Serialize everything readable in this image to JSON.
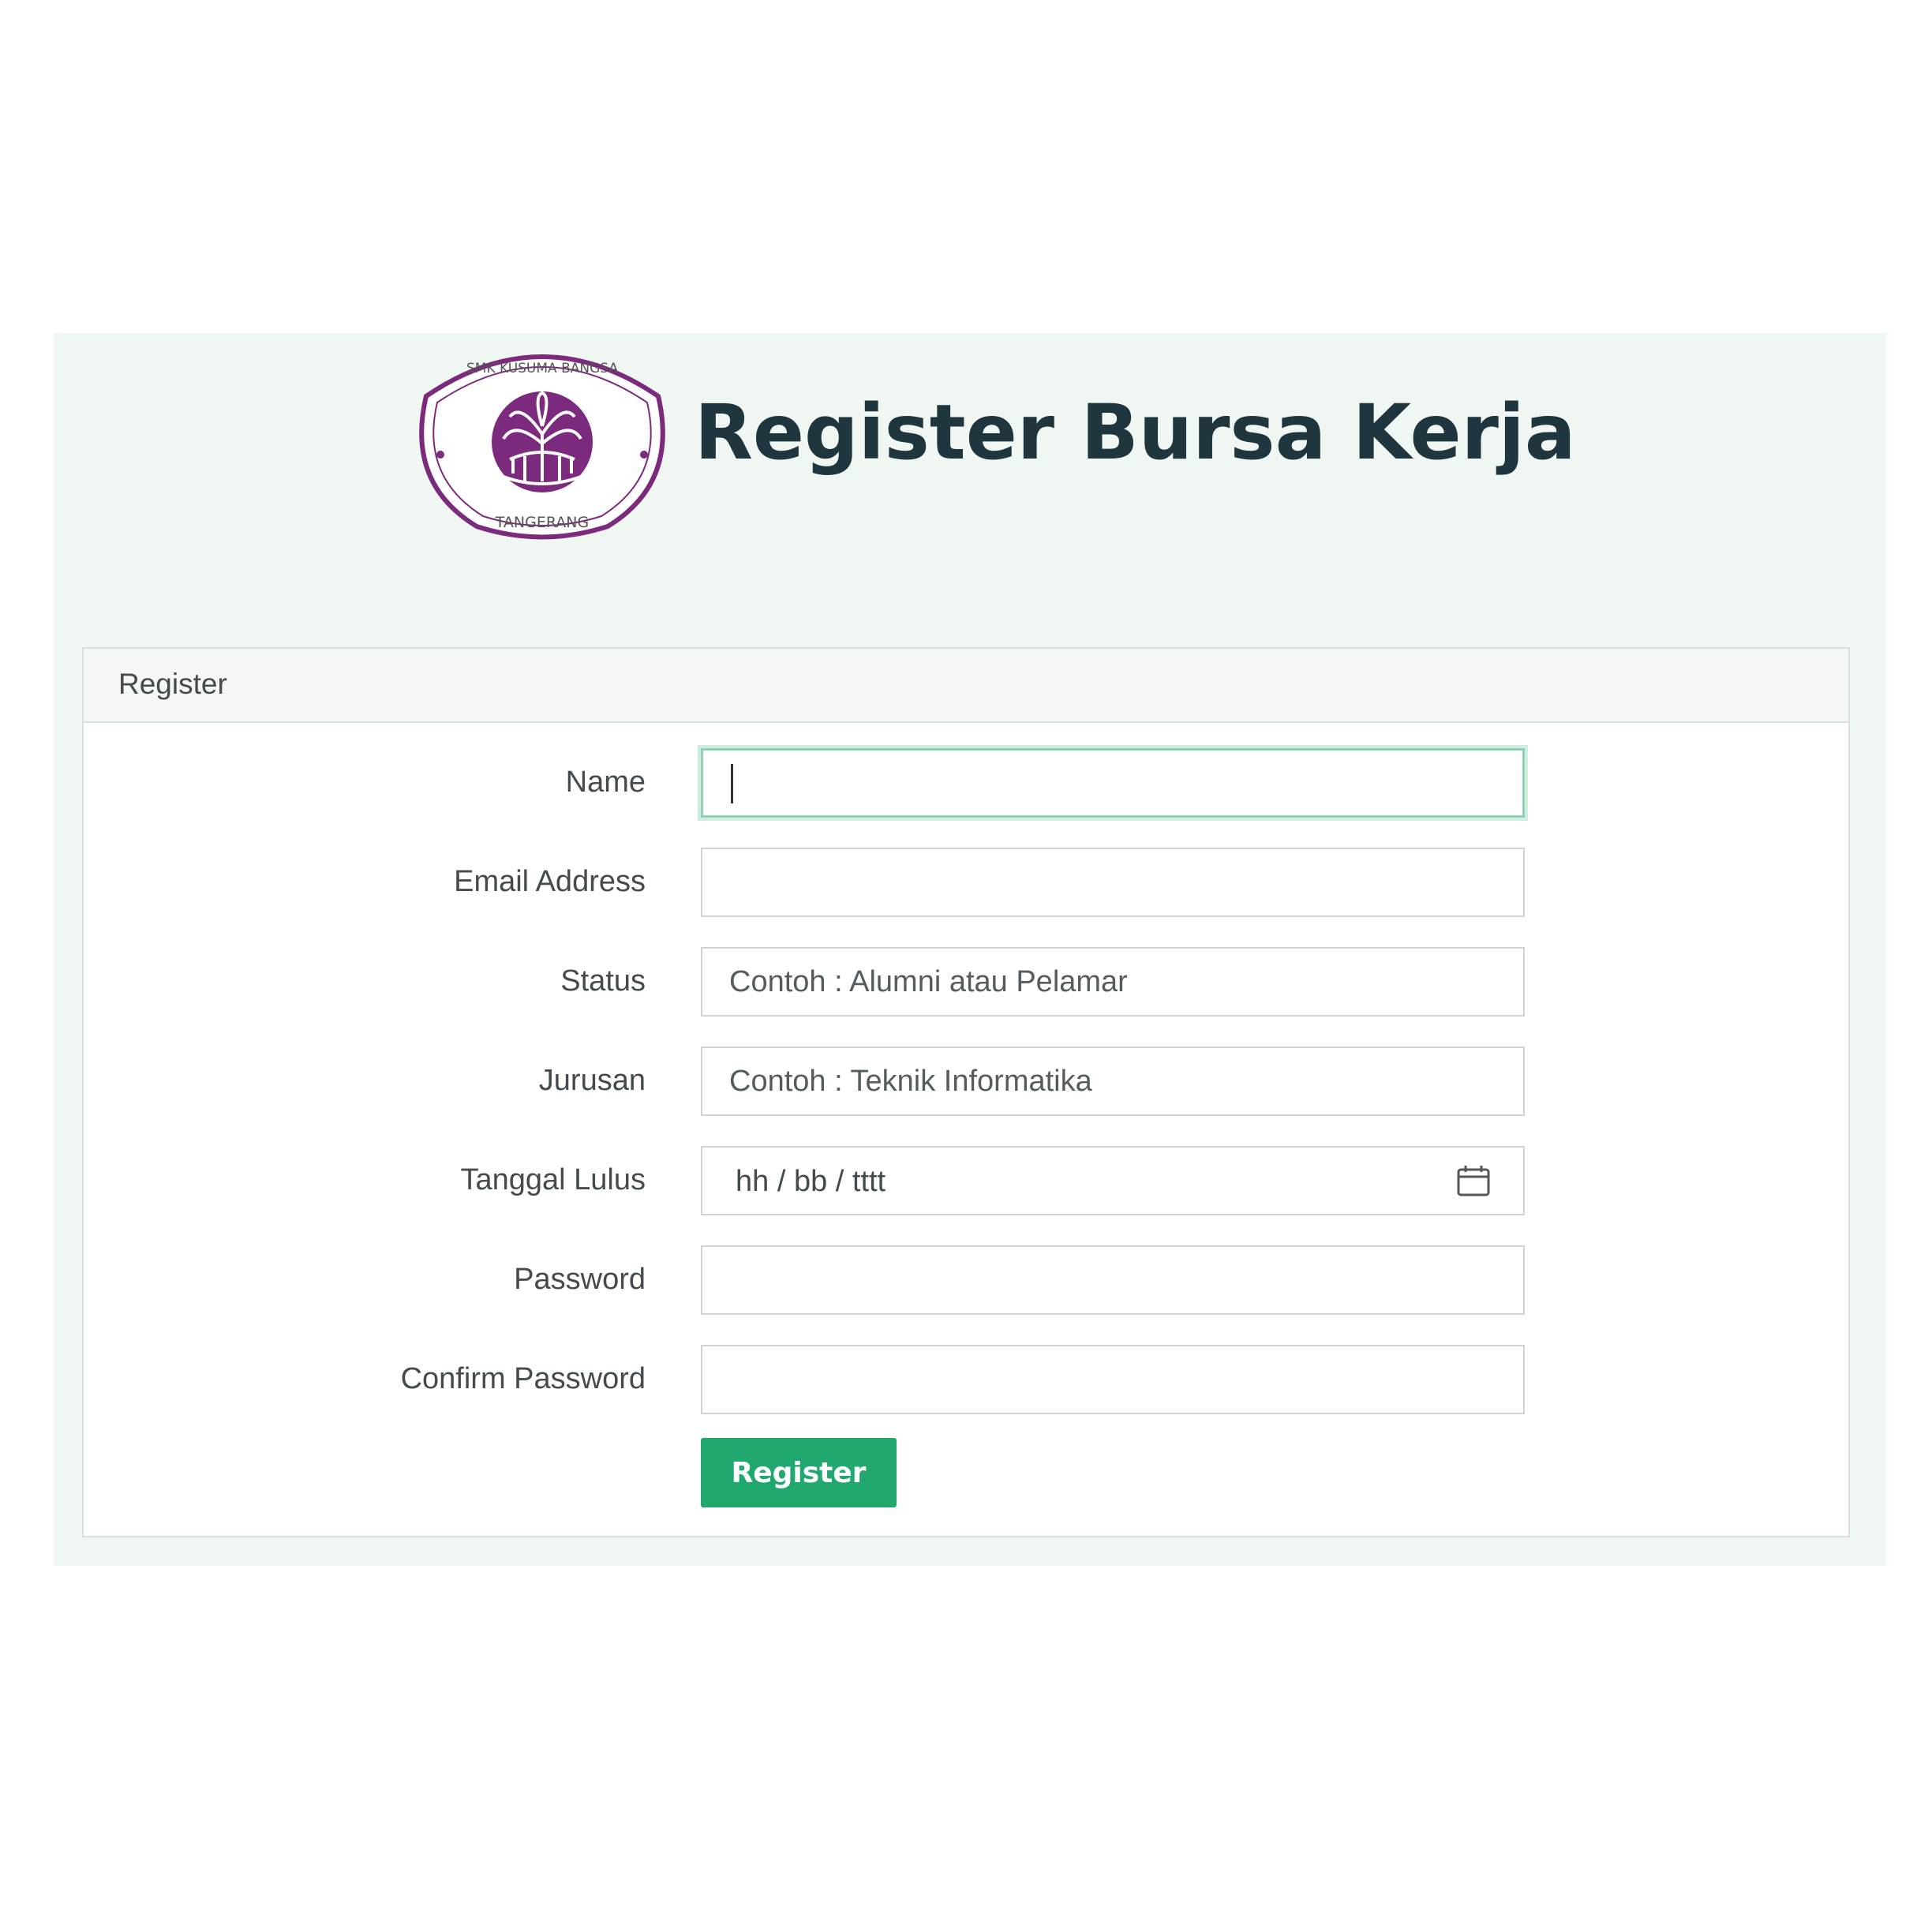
{
  "header": {
    "title": "Register Bursa Kerja",
    "logo": {
      "top_text": "SMK KUSUMA BANGSA",
      "bottom_text": "TANGERANG",
      "color": "#7b2a7e"
    }
  },
  "card": {
    "title": "Register"
  },
  "form": {
    "name": {
      "label": "Name",
      "value": "",
      "placeholder": ""
    },
    "email": {
      "label": "Email Address",
      "value": "",
      "placeholder": ""
    },
    "status": {
      "label": "Status",
      "value": "",
      "placeholder": "Contoh : Alumni atau Pelamar"
    },
    "jurusan": {
      "label": "Jurusan",
      "value": "",
      "placeholder": "Contoh : Teknik Informatika"
    },
    "tanggal_lulus": {
      "label": "Tanggal Lulus",
      "placeholder": "hh / bb / tttt",
      "icon": "calendar-icon"
    },
    "password": {
      "label": "Password",
      "value": ""
    },
    "confirm_password": {
      "label": "Confirm Password",
      "value": ""
    },
    "submit_label": "Register"
  },
  "colors": {
    "panel_background": "#f0f6f2",
    "title": "#1f363f",
    "button": "#21a86f",
    "focus_border": "#8fd1b5"
  }
}
